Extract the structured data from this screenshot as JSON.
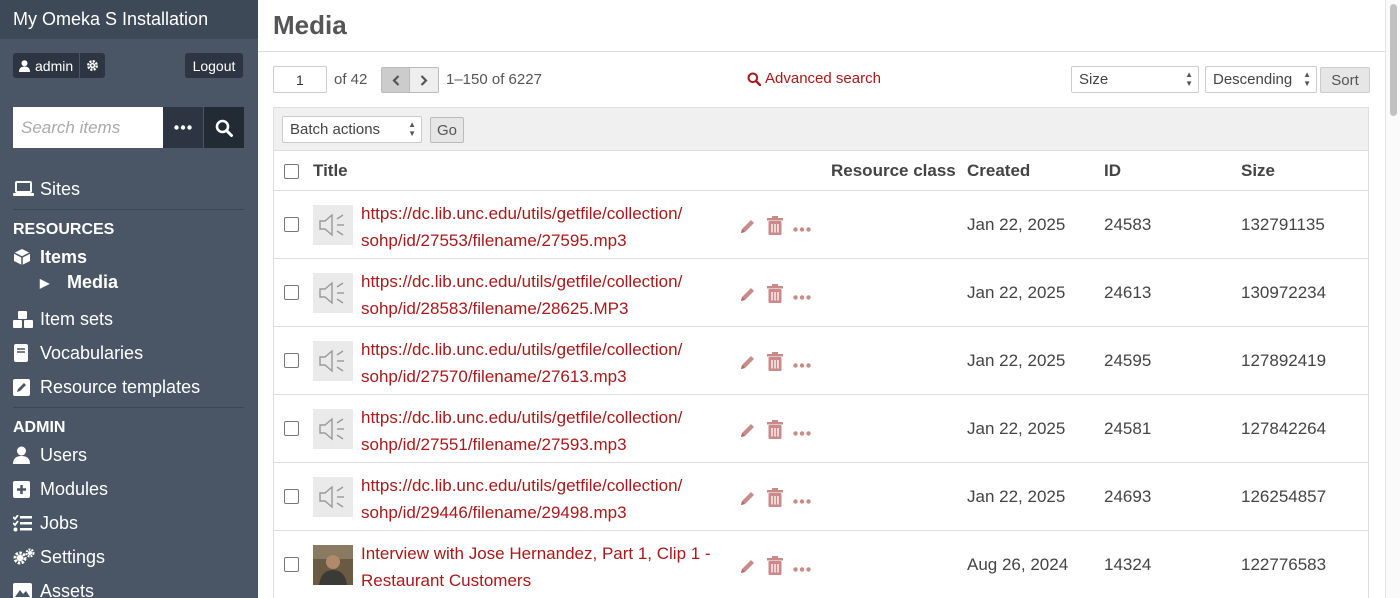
{
  "sidebar": {
    "install_title": "My Omeka S Installation",
    "user": {
      "name": "admin",
      "logout_label": "Logout"
    },
    "search": {
      "placeholder": "Search items"
    },
    "nav": {
      "sites": "Sites",
      "resources_heading": "RESOURCES",
      "items": "Items",
      "media": "Media",
      "item_sets": "Item sets",
      "vocabularies": "Vocabularies",
      "resource_templates": "Resource templates",
      "admin_heading": "ADMIN",
      "users": "Users",
      "modules": "Modules",
      "jobs": "Jobs",
      "settings": "Settings",
      "assets": "Assets"
    }
  },
  "main": {
    "page_title": "Media",
    "pagination": {
      "page": "1",
      "of_label": "of 42",
      "range": "1–150 of 6227"
    },
    "advanced_search_label": "Advanced search",
    "sort": {
      "field": "Size",
      "order": "Descending",
      "button_label": "Sort"
    },
    "batch": {
      "select_label": "Batch actions",
      "go_label": "Go"
    },
    "table": {
      "headers": {
        "title": "Title",
        "resource_class": "Resource class",
        "created": "Created",
        "id": "ID",
        "size": "Size"
      },
      "rows": [
        {
          "title_line1": "https://dc.lib.unc.edu/utils/getfile/collection/",
          "title_line2": "sohp/id/27553/filename/27595.mp3",
          "resource_class": "",
          "created": "Jan 22, 2025",
          "id": "24583",
          "size": "132791135",
          "thumb": "audio"
        },
        {
          "title_line1": "https://dc.lib.unc.edu/utils/getfile/collection/",
          "title_line2": "sohp/id/28583/filename/28625.MP3",
          "resource_class": "",
          "created": "Jan 22, 2025",
          "id": "24613",
          "size": "130972234",
          "thumb": "audio"
        },
        {
          "title_line1": "https://dc.lib.unc.edu/utils/getfile/collection/",
          "title_line2": "sohp/id/27570/filename/27613.mp3",
          "resource_class": "",
          "created": "Jan 22, 2025",
          "id": "24595",
          "size": "127892419",
          "thumb": "audio"
        },
        {
          "title_line1": "https://dc.lib.unc.edu/utils/getfile/collection/",
          "title_line2": "sohp/id/27551/filename/27593.mp3",
          "resource_class": "",
          "created": "Jan 22, 2025",
          "id": "24581",
          "size": "127842264",
          "thumb": "audio"
        },
        {
          "title_line1": "https://dc.lib.unc.edu/utils/getfile/collection/",
          "title_line2": "sohp/id/29446/filename/29498.mp3",
          "resource_class": "",
          "created": "Jan 22, 2025",
          "id": "24693",
          "size": "126254857",
          "thumb": "audio"
        },
        {
          "title_line1": "Interview with Jose Hernandez, Part 1, Clip 1 -",
          "title_line2": "Restaurant Customers",
          "resource_class": "",
          "created": "Aug 26, 2024",
          "id": "14324",
          "size": "122776583",
          "thumb": "photo"
        }
      ]
    }
  },
  "colors": {
    "sidebar_bg": "#4a5666",
    "link": "#a91919"
  }
}
